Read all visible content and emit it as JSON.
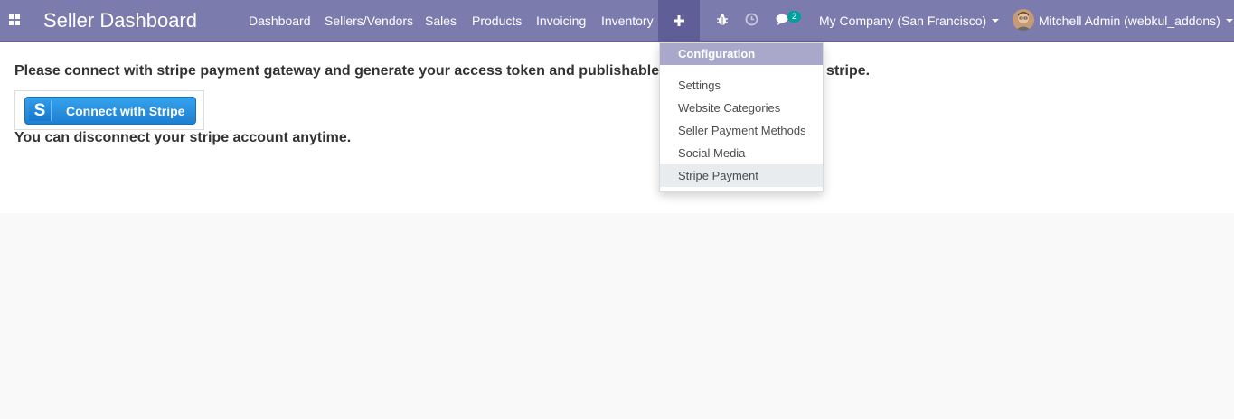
{
  "app": {
    "title": "Seller Dashboard"
  },
  "nav": {
    "items": [
      "Dashboard",
      "Sellers/Vendors",
      "Sales",
      "Products",
      "Invoicing",
      "Inventory"
    ]
  },
  "systray": {
    "icons": [
      "apps-icon",
      "plus-icon",
      "bug-icon",
      "clock-icon",
      "chat-icon"
    ],
    "chat_badge": "2",
    "company": "My Company (San Francisco)",
    "user": "Mitchell Admin (webkul_addons)"
  },
  "main": {
    "info_text": "Please connect with stripe payment gateway and generate your access token and publishable key by connecting with stripe.",
    "stripe_button": {
      "icon_letter": "S",
      "label": "Connect with Stripe"
    },
    "disconnect_text": "You can disconnect your stripe account anytime."
  },
  "dropdown": {
    "header": "Configuration",
    "items": [
      "Settings",
      "Website Categories",
      "Seller Payment Methods",
      "Social Media",
      "Stripe Payment"
    ],
    "active": "Stripe Payment"
  },
  "colors": {
    "navbar": "#7c7bad",
    "dropdown_header": "#a9a8cb",
    "badge": "#00a09d",
    "stripe": "#2f90e0"
  }
}
